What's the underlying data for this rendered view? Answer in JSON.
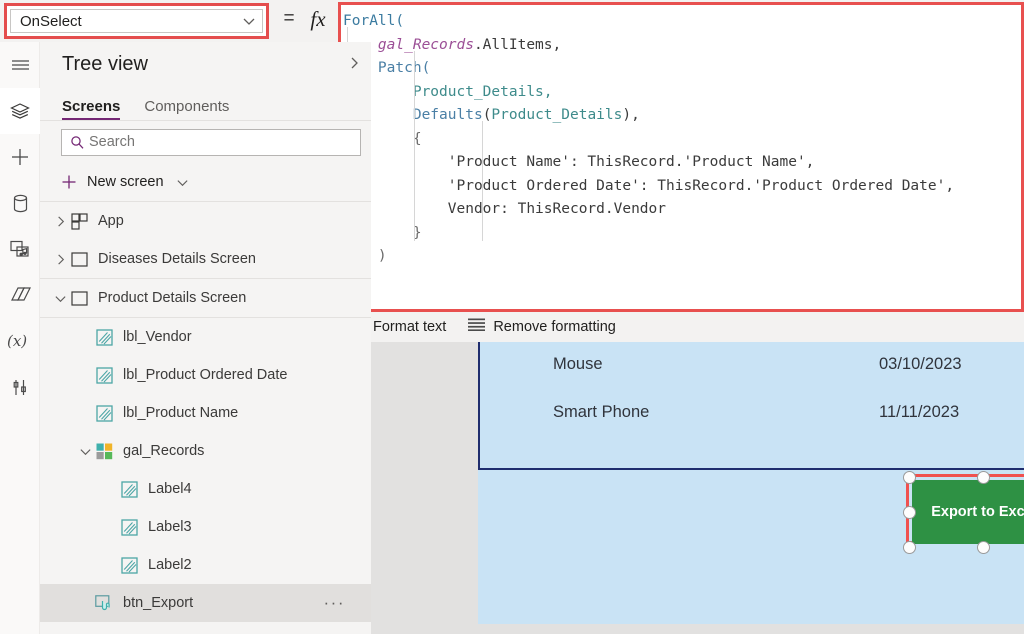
{
  "topbar": {
    "property_value": "OnSelect",
    "equals_symbol": "=",
    "fx_symbol": "fx",
    "chevron_icon": "chevron-down-icon"
  },
  "formula": {
    "lines": [
      [
        {
          "t": "ForAll(",
          "c": "fn"
        }
      ],
      [
        {
          "t": "    ",
          "c": "plain"
        },
        {
          "t": "gal_Records",
          "c": "ctl"
        },
        {
          "t": ".AllItems,",
          "c": "plain"
        }
      ],
      [
        {
          "t": "    ",
          "c": "plain"
        },
        {
          "t": "Patch(",
          "c": "fn2"
        }
      ],
      [
        {
          "t": "        ",
          "c": "plain"
        },
        {
          "t": "Product_Details,",
          "c": "ds"
        }
      ],
      [
        {
          "t": "        ",
          "c": "plain"
        },
        {
          "t": "Defaults",
          "c": "fn2"
        },
        {
          "t": "(",
          "c": "plain"
        },
        {
          "t": "Product_Details",
          "c": "ds"
        },
        {
          "t": "),",
          "c": "plain"
        }
      ],
      [
        {
          "t": "        ",
          "c": "plain"
        },
        {
          "t": "{",
          "c": "punc"
        }
      ],
      [
        {
          "t": "            'Product Name': ThisRecord.'Product Name',",
          "c": "plain"
        }
      ],
      [
        {
          "t": "            'Product Ordered Date': ThisRecord.'Product Ordered Date',",
          "c": "plain"
        }
      ],
      [
        {
          "t": "            Vendor: ThisRecord.Vendor",
          "c": "plain"
        }
      ],
      [
        {
          "t": "        ",
          "c": "plain"
        },
        {
          "t": "}",
          "c": "punc"
        }
      ],
      [
        {
          "t": "    ",
          "c": "plain"
        },
        {
          "t": ")",
          "c": "punc"
        }
      ],
      [
        {
          "t": ")",
          "c": "punc"
        }
      ]
    ]
  },
  "format_bar": {
    "format_text_label": "Format text",
    "format_text_icon": "format-text-icon",
    "remove_formatting_label": "Remove formatting",
    "remove_formatting_icon": "remove-formatting-icon"
  },
  "rail": {
    "items": [
      {
        "name": "hamburger-menu-icon",
        "icon": "hamburger",
        "selected": false
      },
      {
        "name": "tree-view-icon",
        "icon": "layers",
        "selected": true
      },
      {
        "name": "insert-icon",
        "icon": "plus",
        "selected": false
      },
      {
        "name": "data-icon",
        "icon": "database",
        "selected": false
      },
      {
        "name": "media-icon",
        "icon": "media",
        "selected": false
      },
      {
        "name": "power-automate-icon",
        "icon": "flow",
        "selected": false
      },
      {
        "name": "variables-icon",
        "icon": "variables",
        "selected": false
      },
      {
        "name": "search-rail-icon",
        "icon": "search",
        "selected": false
      }
    ]
  },
  "tree": {
    "title": "Tree view",
    "collapse_icon": "chevron-right-icon",
    "tabs": [
      {
        "label": "Screens",
        "active": true
      },
      {
        "label": "Components",
        "active": false
      }
    ],
    "search": {
      "placeholder": "Search",
      "icon": "search-icon"
    },
    "new_screen": {
      "label": "New screen",
      "plus_icon": "plus-icon",
      "chevron_icon": "chevron-down-icon"
    },
    "items": [
      {
        "label": "App",
        "indent": 0,
        "expander": "collapsed",
        "icon": "app-icon",
        "selected": false,
        "more": false
      },
      {
        "label": "Diseases Details Screen",
        "indent": 0,
        "expander": "collapsed",
        "icon": "screen-icon",
        "selected": false,
        "more": false
      },
      {
        "label": "Product Details Screen",
        "indent": 0,
        "expander": "expanded",
        "icon": "screen-icon",
        "selected": false,
        "more": false
      },
      {
        "label": "lbl_Vendor",
        "indent": 1,
        "expander": "none",
        "icon": "label-icon",
        "selected": false,
        "more": false
      },
      {
        "label": "lbl_Product Ordered Date",
        "indent": 1,
        "expander": "none",
        "icon": "label-icon",
        "selected": false,
        "more": false
      },
      {
        "label": "lbl_Product Name",
        "indent": 1,
        "expander": "none",
        "icon": "label-icon",
        "selected": false,
        "more": false
      },
      {
        "label": "gal_Records",
        "indent": 1,
        "expander": "expanded",
        "icon": "gallery-icon",
        "selected": false,
        "more": false
      },
      {
        "label": "Label4",
        "indent": 2,
        "expander": "none",
        "icon": "label-icon",
        "selected": false,
        "more": false
      },
      {
        "label": "Label3",
        "indent": 2,
        "expander": "none",
        "icon": "label-icon",
        "selected": false,
        "more": false
      },
      {
        "label": "Label2",
        "indent": 2,
        "expander": "none",
        "icon": "label-icon",
        "selected": false,
        "more": false
      },
      {
        "label": "btn_Export",
        "indent": 1,
        "expander": "none",
        "icon": "button-icon",
        "selected": true,
        "more": true,
        "more_label": "···"
      }
    ]
  },
  "canvas": {
    "gallery_rows": [
      {
        "product": "Mouse",
        "date": "03/10/2023"
      },
      {
        "product": "Smart Phone",
        "date": "11/11/2023"
      }
    ],
    "export_button": {
      "label": "Export to Excel",
      "fill_color": "#2e9144",
      "selection_color": "#f0514f"
    },
    "screen_fill": "#c9e3f5"
  }
}
